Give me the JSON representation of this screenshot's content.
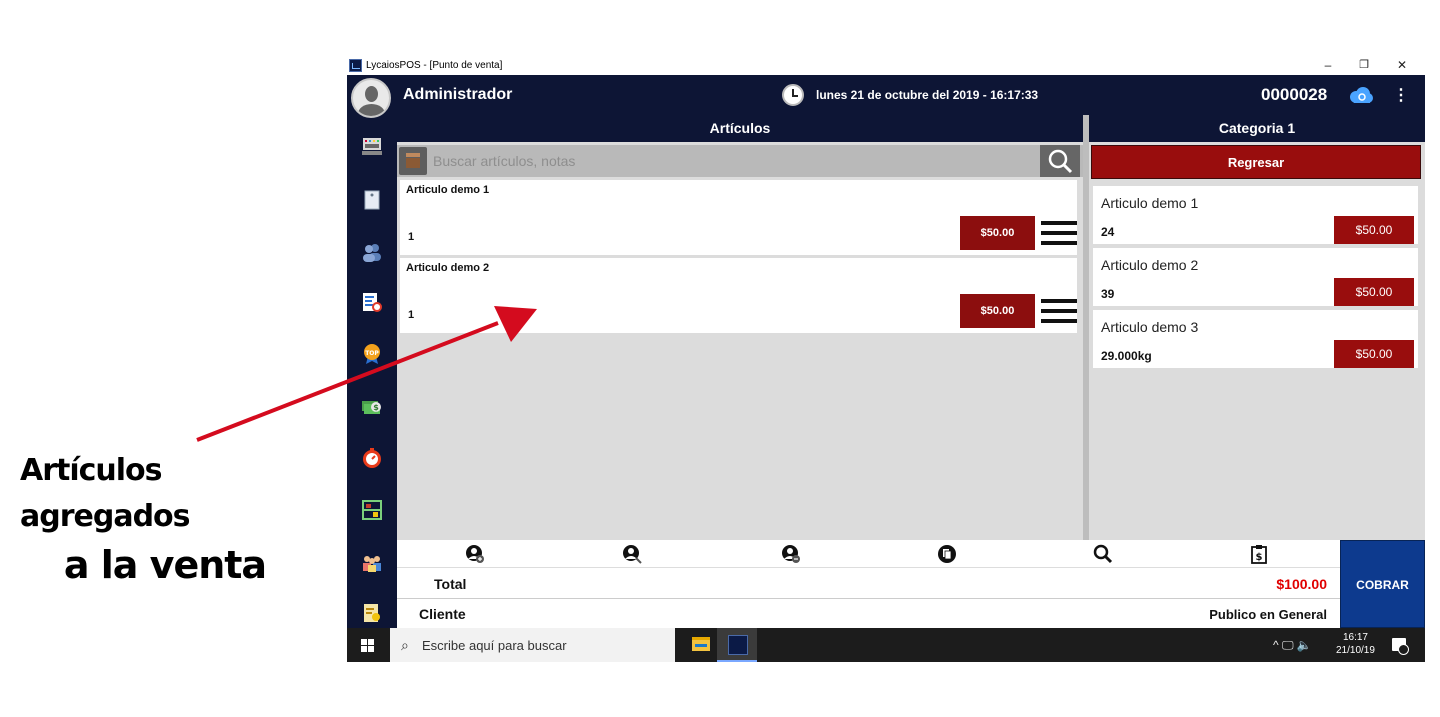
{
  "window": {
    "title": "LycaiosPOS - [Punto de venta]",
    "min_label": "–",
    "restore_label": "❐",
    "close_label": "✕"
  },
  "header": {
    "user": "Administrador",
    "datetime": "lunes 21 de octubre del 2019 - 16:17:33",
    "ticket_number": "0000028",
    "menu_glyph": "⋮"
  },
  "articles_panel": {
    "title": "Artículos",
    "search_placeholder": "Buscar artículos, notas",
    "items": [
      {
        "name": "Articulo demo 1",
        "qty": "1",
        "price": "$50.00"
      },
      {
        "name": "Articulo demo 2",
        "qty": "1",
        "price": "$50.00"
      }
    ]
  },
  "category_panel": {
    "title": "Categoria 1",
    "back_label": "Regresar",
    "items": [
      {
        "name": "Articulo demo 1",
        "stock": "24",
        "price": "$50.00"
      },
      {
        "name": "Articulo demo 2",
        "stock": "39",
        "price": "$50.00"
      },
      {
        "name": "Articulo demo 3",
        "stock": "29.000kg",
        "price": "$50.00"
      }
    ]
  },
  "totals": {
    "total_label": "Total",
    "total_value": "$100.00",
    "client_label": "Cliente",
    "client_value": "Publico en General"
  },
  "cobrar_label": "COBRAR",
  "taskbar": {
    "search_placeholder": "Escribe aquí para buscar",
    "time": "16:17",
    "date": "21/10/19",
    "tray": "^ 🖵 🔈"
  },
  "annotation": {
    "line1": "Artículos agregados",
    "line2": "a la venta"
  },
  "colors": {
    "navy": "#0d1535",
    "price_red": "#990d0d",
    "cobrar_blue": "#0d3a8e",
    "total_red": "#e00000"
  }
}
